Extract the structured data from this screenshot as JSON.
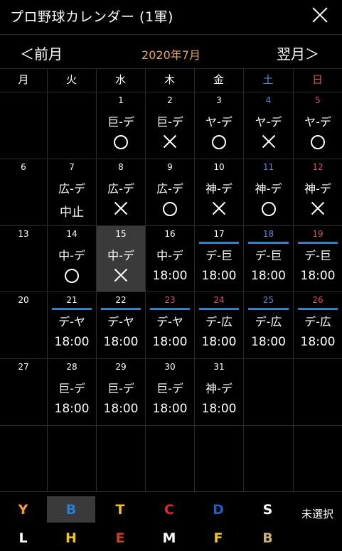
{
  "header": {
    "title": "プロ野球カレンダー (1軍)",
    "close_icon": "close-icon"
  },
  "nav": {
    "prev_label": "＜前月",
    "month_label": "2020年7月",
    "next_label": "翌月＞"
  },
  "colors": {
    "saturday": "#5b86d6",
    "sunday": "#d8506a",
    "month": "#e8a85a",
    "bar": "#2f82c8"
  },
  "weekdays": [
    "月",
    "火",
    "水",
    "木",
    "金",
    "土",
    "日"
  ],
  "weeks": [
    [
      {
        "day": "",
        "holiday": false,
        "matchup": "",
        "result": "",
        "bar": false,
        "today": false
      },
      {
        "day": "",
        "holiday": false,
        "matchup": "",
        "result": "",
        "bar": false,
        "today": false
      },
      {
        "day": "1",
        "holiday": false,
        "matchup": "巨-デ",
        "result": "○",
        "bar": false,
        "today": false
      },
      {
        "day": "2",
        "holiday": false,
        "matchup": "巨-デ",
        "result": "×",
        "bar": false,
        "today": false
      },
      {
        "day": "3",
        "holiday": false,
        "matchup": "ヤ-デ",
        "result": "○",
        "bar": false,
        "today": false
      },
      {
        "day": "4",
        "holiday": false,
        "matchup": "ヤ-デ",
        "result": "×",
        "bar": false,
        "today": false
      },
      {
        "day": "5",
        "holiday": false,
        "matchup": "ヤ-デ",
        "result": "○",
        "bar": false,
        "today": false
      }
    ],
    [
      {
        "day": "6",
        "holiday": false,
        "matchup": "",
        "result": "",
        "bar": false,
        "today": false
      },
      {
        "day": "7",
        "holiday": false,
        "matchup": "広-デ",
        "result": "中止",
        "bar": false,
        "today": false
      },
      {
        "day": "8",
        "holiday": false,
        "matchup": "広-デ",
        "result": "×",
        "bar": false,
        "today": false
      },
      {
        "day": "9",
        "holiday": false,
        "matchup": "広-デ",
        "result": "○",
        "bar": false,
        "today": false
      },
      {
        "day": "10",
        "holiday": false,
        "matchup": "神-デ",
        "result": "×",
        "bar": false,
        "today": false
      },
      {
        "day": "11",
        "holiday": false,
        "matchup": "神-デ",
        "result": "○",
        "bar": false,
        "today": false
      },
      {
        "day": "12",
        "holiday": false,
        "matchup": "神-デ",
        "result": "×",
        "bar": false,
        "today": false
      }
    ],
    [
      {
        "day": "13",
        "holiday": false,
        "matchup": "",
        "result": "",
        "bar": false,
        "today": false
      },
      {
        "day": "14",
        "holiday": false,
        "matchup": "中-デ",
        "result": "○",
        "bar": false,
        "today": false
      },
      {
        "day": "15",
        "holiday": false,
        "matchup": "中-デ",
        "result": "×",
        "bar": false,
        "today": true
      },
      {
        "day": "16",
        "holiday": false,
        "matchup": "中-デ",
        "result": "18:00",
        "bar": false,
        "today": false
      },
      {
        "day": "17",
        "holiday": false,
        "matchup": "デ-巨",
        "result": "18:00",
        "bar": true,
        "today": false
      },
      {
        "day": "18",
        "holiday": false,
        "matchup": "デ-巨",
        "result": "18:00",
        "bar": true,
        "today": false
      },
      {
        "day": "19",
        "holiday": false,
        "matchup": "デ-巨",
        "result": "18:00",
        "bar": true,
        "today": false
      }
    ],
    [
      {
        "day": "20",
        "holiday": false,
        "matchup": "",
        "result": "",
        "bar": false,
        "today": false
      },
      {
        "day": "21",
        "holiday": false,
        "matchup": "デ-ヤ",
        "result": "18:00",
        "bar": true,
        "today": false
      },
      {
        "day": "22",
        "holiday": false,
        "matchup": "デ-ヤ",
        "result": "18:00",
        "bar": true,
        "today": false
      },
      {
        "day": "23",
        "holiday": true,
        "matchup": "デ-ヤ",
        "result": "18:00",
        "bar": true,
        "today": false
      },
      {
        "day": "24",
        "holiday": true,
        "matchup": "デ-広",
        "result": "18:00",
        "bar": true,
        "today": false
      },
      {
        "day": "25",
        "holiday": false,
        "matchup": "デ-広",
        "result": "18:00",
        "bar": true,
        "today": false
      },
      {
        "day": "26",
        "holiday": false,
        "matchup": "デ-広",
        "result": "18:00",
        "bar": true,
        "today": false
      }
    ],
    [
      {
        "day": "27",
        "holiday": false,
        "matchup": "",
        "result": "",
        "bar": false,
        "today": false
      },
      {
        "day": "28",
        "holiday": false,
        "matchup": "巨-デ",
        "result": "18:00",
        "bar": false,
        "today": false
      },
      {
        "day": "29",
        "holiday": false,
        "matchup": "巨-デ",
        "result": "18:00",
        "bar": false,
        "today": false
      },
      {
        "day": "30",
        "holiday": false,
        "matchup": "巨-デ",
        "result": "18:00",
        "bar": false,
        "today": false
      },
      {
        "day": "31",
        "holiday": false,
        "matchup": "神-デ",
        "result": "18:00",
        "bar": false,
        "today": false
      },
      {
        "day": "",
        "holiday": false,
        "matchup": "",
        "result": "",
        "bar": false,
        "today": false
      },
      {
        "day": "",
        "holiday": false,
        "matchup": "",
        "result": "",
        "bar": false,
        "today": false
      }
    ],
    [
      {
        "day": "",
        "holiday": false,
        "matchup": "",
        "result": "",
        "bar": false,
        "today": false
      },
      {
        "day": "",
        "holiday": false,
        "matchup": "",
        "result": "",
        "bar": false,
        "today": false
      },
      {
        "day": "",
        "holiday": false,
        "matchup": "",
        "result": "",
        "bar": false,
        "today": false
      },
      {
        "day": "",
        "holiday": false,
        "matchup": "",
        "result": "",
        "bar": false,
        "today": false
      },
      {
        "day": "",
        "holiday": false,
        "matchup": "",
        "result": "",
        "bar": false,
        "today": false
      },
      {
        "day": "",
        "holiday": false,
        "matchup": "",
        "result": "",
        "bar": false,
        "today": false
      },
      {
        "day": "",
        "holiday": false,
        "matchup": "",
        "result": "",
        "bar": false,
        "today": false
      }
    ]
  ],
  "teams": {
    "row1": [
      {
        "icon": "giants-logo-icon",
        "color": "#f29b3a",
        "selected": false
      },
      {
        "icon": "baystars-logo-icon",
        "color": "#2a7cd6",
        "selected": true
      },
      {
        "icon": "tigers-logo-icon",
        "color": "#f1c232",
        "selected": false
      },
      {
        "icon": "carp-logo-icon",
        "color": "#d8283a",
        "selected": false
      },
      {
        "icon": "dragons-logo-icon",
        "color": "#1f5fbf",
        "selected": false
      },
      {
        "icon": "swallows-logo-icon",
        "color": "#ffffff",
        "selected": false
      }
    ],
    "row2": [
      {
        "icon": "lions-logo-icon",
        "color": "#ffffff",
        "selected": false
      },
      {
        "icon": "hawks-logo-icon",
        "color": "#f1c232",
        "selected": false
      },
      {
        "icon": "eagles-logo-icon",
        "color": "#c8402a",
        "selected": false
      },
      {
        "icon": "marines-logo-icon",
        "color": "#ffffff",
        "selected": false
      },
      {
        "icon": "fighters-logo-icon",
        "color": "#f1c232",
        "selected": false
      },
      {
        "icon": "buffaloes-logo-icon",
        "color": "#c9b37a",
        "selected": false
      }
    ],
    "unselected_label": "未選択"
  }
}
